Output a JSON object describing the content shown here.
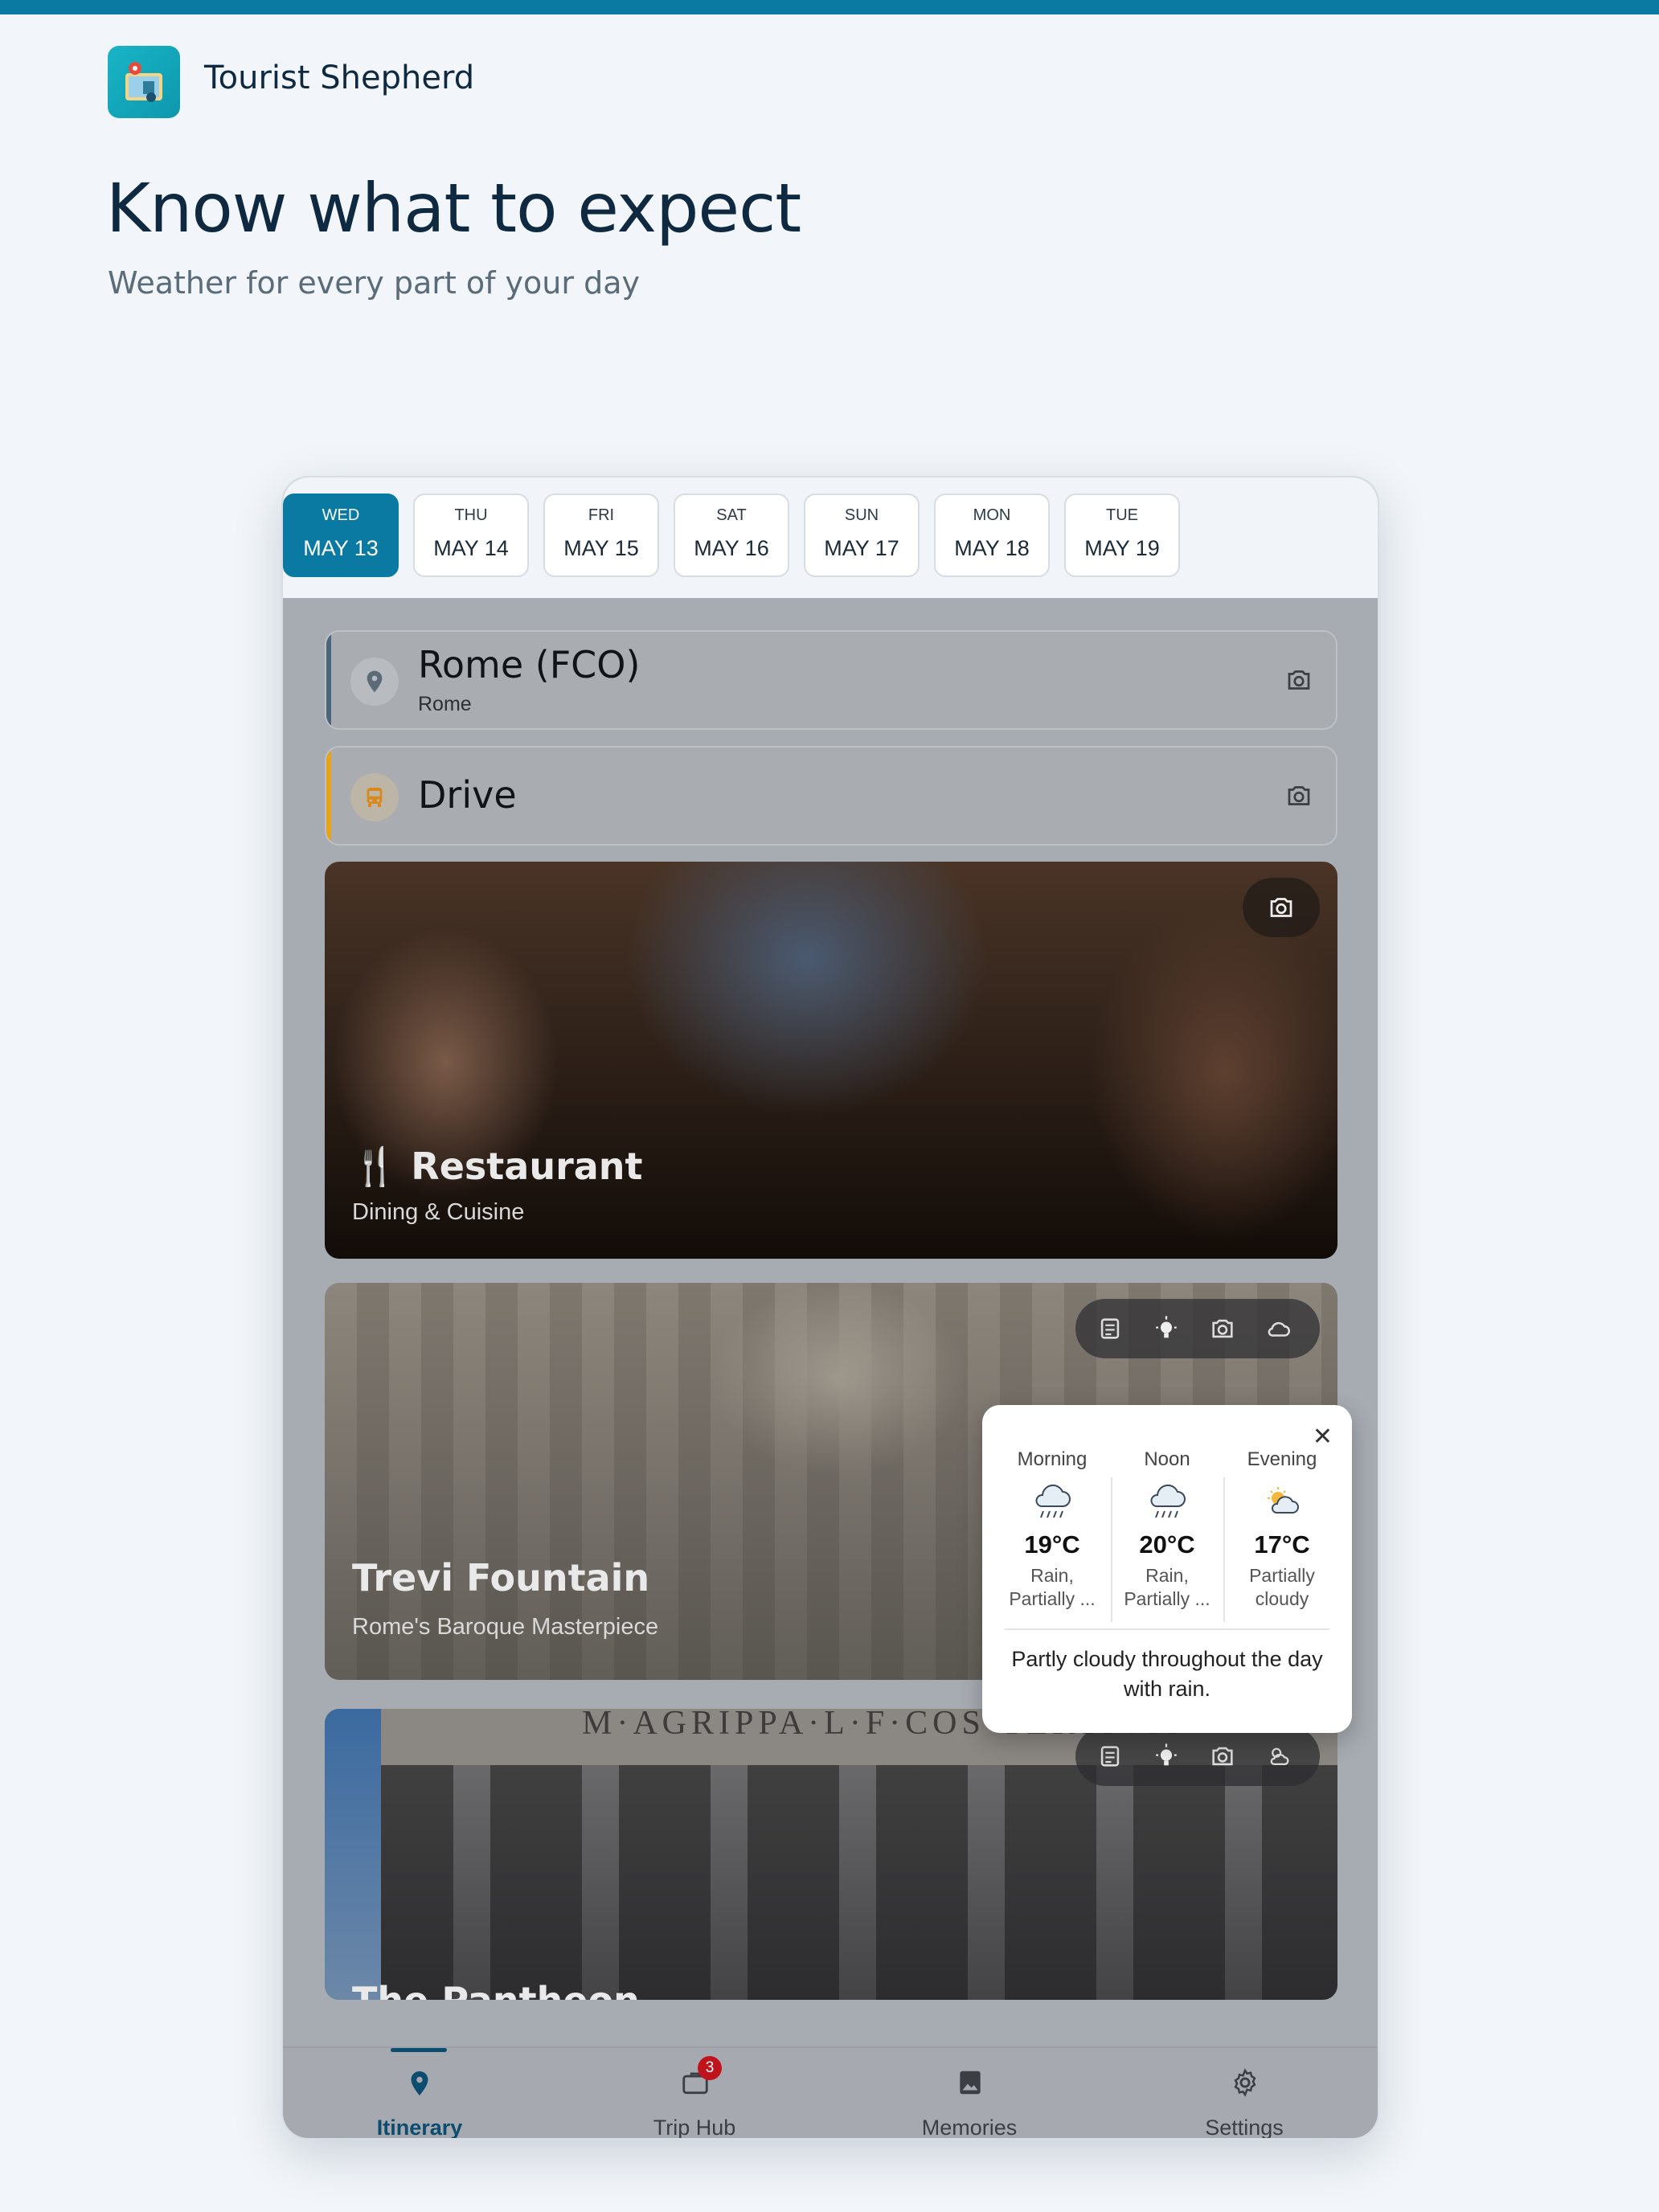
{
  "app": {
    "name": "Tourist Shepherd"
  },
  "hero": {
    "headline": "Know what to expect",
    "subheadline": "Weather for every part of your day"
  },
  "days": [
    {
      "dow": "WED",
      "date": "MAY 13",
      "active": true
    },
    {
      "dow": "THU",
      "date": "MAY 14"
    },
    {
      "dow": "FRI",
      "date": "MAY 15"
    },
    {
      "dow": "SAT",
      "date": "MAY 16"
    },
    {
      "dow": "SUN",
      "date": "MAY 17"
    },
    {
      "dow": "MON",
      "date": "MAY 18"
    },
    {
      "dow": "TUE",
      "date": "MAY 19"
    }
  ],
  "itinerary": {
    "location": {
      "title": "Rome (FCO)",
      "subtitle": "Rome",
      "accent": "#4a6478"
    },
    "transport": {
      "title": "Drive",
      "accent": "#e8a317"
    },
    "restaurant": {
      "title": "Restaurant",
      "subtitle": "Dining & Cuisine"
    },
    "trevi": {
      "title": "Trevi Fountain",
      "subtitle": "Rome's Baroque Masterpiece"
    },
    "pantheon": {
      "title": "The Pantheon",
      "inscription": "M·AGRIPPA·L·F·COS·TERTIVM"
    }
  },
  "weather_popup": {
    "periods": [
      {
        "label": "Morning",
        "temp": "19°C",
        "desc_line1": "Rain,",
        "desc_line2": "Partially ...",
        "icon": "rain-cloud-icon"
      },
      {
        "label": "Noon",
        "temp": "20°C",
        "desc_line1": "Rain,",
        "desc_line2": "Partially ...",
        "icon": "rain-cloud-icon"
      },
      {
        "label": "Evening",
        "temp": "17°C",
        "desc_line1": "Partially",
        "desc_line2": "cloudy",
        "icon": "sun-cloud-icon"
      }
    ],
    "summary": "Partly cloudy throughout the day with rain."
  },
  "nav": {
    "itinerary": "Itinerary",
    "trip_hub": "Trip Hub",
    "trip_hub_badge": "3",
    "memories": "Memories",
    "settings": "Settings"
  },
  "colors": {
    "brand": "#0a7aa3",
    "nav_active": "#0c4c6e",
    "badge": "#c0141c"
  }
}
